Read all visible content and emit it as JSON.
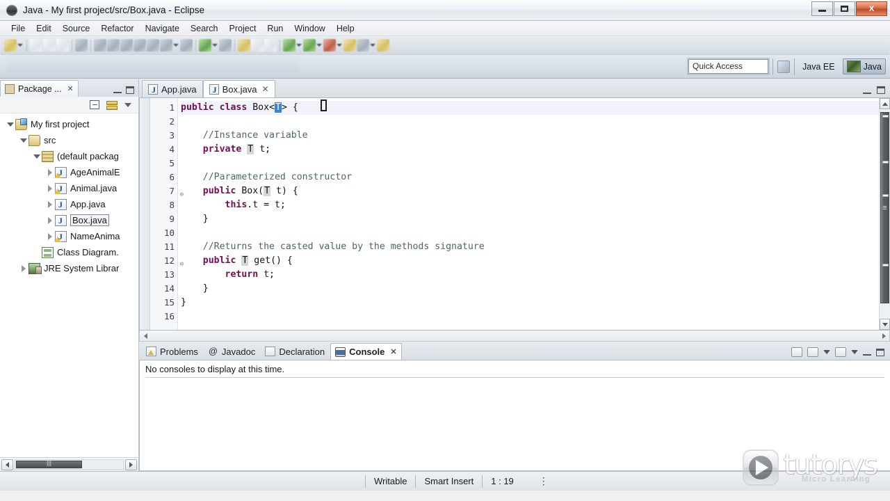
{
  "window": {
    "title": "Java - My first project/src/Box.java - Eclipse",
    "app_icon": "eclipse-icon",
    "minimize_label": "Minimize",
    "maximize_label": "Maximize",
    "close_label": "X"
  },
  "menubar": {
    "items": [
      {
        "label": "File"
      },
      {
        "label": "Edit"
      },
      {
        "label": "Source"
      },
      {
        "label": "Refactor"
      },
      {
        "label": "Navigate"
      },
      {
        "label": "Search"
      },
      {
        "label": "Project"
      },
      {
        "label": "Run"
      },
      {
        "label": "Window"
      },
      {
        "label": "Help"
      }
    ]
  },
  "coolbar": {
    "quick_access_placeholder": "Quick Access",
    "quick_access_value": "",
    "perspectives": [
      {
        "label": "Java EE",
        "active": false
      },
      {
        "label": "Java",
        "active": true
      }
    ],
    "open_perspective_icon": "open-perspective-icon"
  },
  "package_explorer": {
    "tab_label": "Package ...",
    "tab_icon": "package-explorer-icon",
    "close_icon": "close-icon",
    "toolbar": {
      "collapse_all": "collapse-all-icon",
      "link_with_editor": "link-with-editor-icon",
      "view_menu": "view-menu-icon"
    },
    "tree": [
      {
        "label": "My first project",
        "icon": "java-project-icon",
        "twisty": "open",
        "indent": 0,
        "selected": false
      },
      {
        "label": "src",
        "icon": "source-folder-icon",
        "twisty": "open",
        "indent": 1,
        "selected": false
      },
      {
        "label": "(default packag",
        "icon": "package-icon",
        "twisty": "open",
        "indent": 2,
        "selected": false
      },
      {
        "label": "AgeAnimalE",
        "icon": "java-file-warn-icon",
        "twisty": "closed",
        "indent": 3,
        "selected": false
      },
      {
        "label": "Animal.java",
        "icon": "java-file-warn-icon",
        "twisty": "closed",
        "indent": 3,
        "selected": false
      },
      {
        "label": "App.java",
        "icon": "java-file-icon",
        "twisty": "closed",
        "indent": 3,
        "selected": false
      },
      {
        "label": "Box.java",
        "icon": "java-file-icon",
        "twisty": "closed",
        "indent": 3,
        "selected": true
      },
      {
        "label": "NameAnima",
        "icon": "java-file-warn-icon",
        "twisty": "closed",
        "indent": 3,
        "selected": false
      },
      {
        "label": "Class Diagram.",
        "icon": "class-diagram-icon",
        "twisty": "none",
        "indent": 2,
        "selected": false
      },
      {
        "label": "JRE System Librar",
        "icon": "jre-library-icon",
        "twisty": "closed",
        "indent": 1,
        "selected": false
      }
    ],
    "hscroll": "horizontal-scrollbar"
  },
  "editor": {
    "tabs": [
      {
        "label": "App.java",
        "active": false,
        "closable": false
      },
      {
        "label": "Box.java",
        "active": true,
        "closable": true
      }
    ],
    "close_icon": "close-icon",
    "lines": [
      {
        "n": "1",
        "fold": "",
        "current": true,
        "tokens": [
          {
            "t": "public",
            "c": "kw"
          },
          {
            "t": " ",
            "c": "pl"
          },
          {
            "t": "class",
            "c": "kw"
          },
          {
            "t": " Box<",
            "c": "pl"
          },
          {
            "t": "T",
            "c": "sel"
          },
          {
            "t": "> {",
            "c": "pl"
          }
        ]
      },
      {
        "n": "2",
        "fold": "",
        "current": false,
        "tokens": []
      },
      {
        "n": "3",
        "fold": "",
        "current": false,
        "tokens": [
          {
            "t": "    //Instance variable",
            "c": "cmt"
          }
        ]
      },
      {
        "n": "4",
        "fold": "",
        "current": false,
        "tokens": [
          {
            "t": "    ",
            "c": "pl"
          },
          {
            "t": "private",
            "c": "kw"
          },
          {
            "t": " ",
            "c": "pl"
          },
          {
            "t": "T",
            "c": "occ"
          },
          {
            "t": " t;",
            "c": "pl"
          }
        ]
      },
      {
        "n": "5",
        "fold": "",
        "current": false,
        "tokens": []
      },
      {
        "n": "6",
        "fold": "",
        "current": false,
        "tokens": [
          {
            "t": "    //Parameterized constructor",
            "c": "cmt"
          }
        ]
      },
      {
        "n": "7",
        "fold": "⊖",
        "current": false,
        "tokens": [
          {
            "t": "    ",
            "c": "pl"
          },
          {
            "t": "public",
            "c": "kw"
          },
          {
            "t": " Box(",
            "c": "pl"
          },
          {
            "t": "T",
            "c": "occ"
          },
          {
            "t": " t) {",
            "c": "pl"
          }
        ]
      },
      {
        "n": "8",
        "fold": "",
        "current": false,
        "tokens": [
          {
            "t": "        ",
            "c": "pl"
          },
          {
            "t": "this",
            "c": "kw"
          },
          {
            "t": ".t = t;",
            "c": "pl"
          }
        ]
      },
      {
        "n": "9",
        "fold": "",
        "current": false,
        "tokens": [
          {
            "t": "    }",
            "c": "pl"
          }
        ]
      },
      {
        "n": "10",
        "fold": "",
        "current": false,
        "tokens": []
      },
      {
        "n": "11",
        "fold": "",
        "current": false,
        "tokens": [
          {
            "t": "    //Returns the casted value by the methods signature",
            "c": "cmt"
          }
        ]
      },
      {
        "n": "12",
        "fold": "⊖",
        "current": false,
        "tokens": [
          {
            "t": "    ",
            "c": "pl"
          },
          {
            "t": "public",
            "c": "kw"
          },
          {
            "t": " ",
            "c": "pl"
          },
          {
            "t": "T",
            "c": "occ"
          },
          {
            "t": " get() {",
            "c": "pl"
          }
        ]
      },
      {
        "n": "13",
        "fold": "",
        "current": false,
        "tokens": [
          {
            "t": "        ",
            "c": "pl"
          },
          {
            "t": "return",
            "c": "kw"
          },
          {
            "t": " t;",
            "c": "pl"
          }
        ]
      },
      {
        "n": "14",
        "fold": "",
        "current": false,
        "tokens": [
          {
            "t": "    }",
            "c": "pl"
          }
        ]
      },
      {
        "n": "15",
        "fold": "",
        "current": false,
        "tokens": [
          {
            "t": "}",
            "c": "pl"
          }
        ]
      },
      {
        "n": "16",
        "fold": "",
        "current": false,
        "tokens": []
      }
    ],
    "minimize_icon": "minimize-icon",
    "maximize_icon": "maximize-icon",
    "vscroll": "vertical-scrollbar",
    "hscroll": "horizontal-scrollbar"
  },
  "bottom_panel": {
    "tabs": [
      {
        "label": "Problems",
        "icon": "problems-icon",
        "active": false,
        "closable": false
      },
      {
        "label": "Javadoc",
        "icon": "javadoc-icon",
        "active": false,
        "closable": false
      },
      {
        "label": "Declaration",
        "icon": "declaration-icon",
        "active": false,
        "closable": false
      },
      {
        "label": "Console",
        "icon": "console-icon",
        "active": true,
        "closable": true
      }
    ],
    "close_icon": "close-icon",
    "message": "No consoles to display at this time.",
    "controls": [
      "open-console-icon",
      "display-selected-console-icon",
      "console-dropdown-icon",
      "new-console-view-icon",
      "new-console-dropdown-icon",
      "minimize-icon",
      "maximize-icon"
    ]
  },
  "statusbar": {
    "writable": "Writable",
    "insert_mode": "Smart Insert",
    "cursor_position": "1 : 19",
    "more_icon": "vertical-dots-icon"
  },
  "watermark": {
    "brand": "tutorys",
    "tagline": "Micro Learning",
    "icon": "play-button-icon"
  },
  "colors": {
    "keyword": "#7a0a55",
    "comment": "#4a6b53",
    "plain": "#111417",
    "selection": "#3a84d8",
    "occurrence": "#d6d6d6",
    "titlebar_close": "#bb4a26"
  }
}
